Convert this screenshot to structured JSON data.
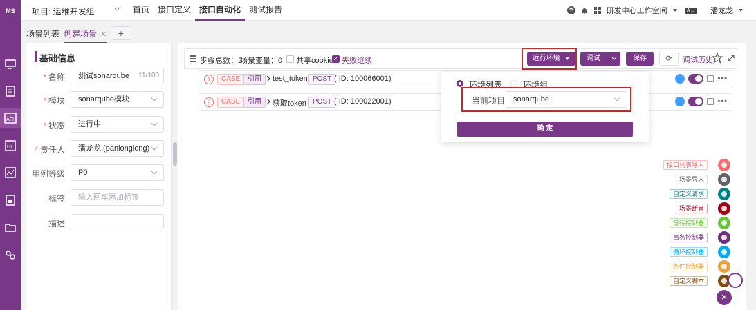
{
  "app": {
    "logo_text": "MS",
    "accent_color": "#783887"
  },
  "topbar": {
    "project": "项目: 运维开发组",
    "nav": [
      "首页",
      "接口定义",
      "接口自动化",
      "测试报告"
    ],
    "active_nav": "接口自动化",
    "workspace": "研发中心工作空间",
    "lang_icon_text": "A↔",
    "user": "潘龙龙"
  },
  "tabs": {
    "list": "场景列表",
    "create": "创建场景",
    "add": "+"
  },
  "info": {
    "title": "基础信息",
    "fields": {
      "name": {
        "label": "名称",
        "value": "测试sonarqube",
        "count": "11/100"
      },
      "module": {
        "label": "模块",
        "value": "sonarqube模块"
      },
      "status": {
        "label": "状态",
        "value": "进行中"
      },
      "owner": {
        "label": "责任人",
        "value": "潘龙龙 (panlonglong)"
      },
      "level": {
        "label": "用例等级",
        "value": "P0"
      },
      "tags": {
        "label": "标签",
        "placeholder": "输入回车添加标签"
      },
      "desc": {
        "label": "描述",
        "value": ""
      }
    }
  },
  "toolbar": {
    "steps_total": "步骤总数：2",
    "vars_label": "场景变量",
    "vars_value": "：0",
    "share_cookie": "共享cookie",
    "continue_on_fail": "失败继续",
    "run_env": "运行环境",
    "debug": "调试",
    "save": "保存",
    "history": "调试历史"
  },
  "steps": [
    {
      "num": "1",
      "type": "CASE",
      "ref": "引用",
      "name": "test_token",
      "method": "POST",
      "id": "( ID: 100066001)"
    },
    {
      "num": "2",
      "type": "CASE",
      "ref": "引用",
      "name": "获取token",
      "method": "POST",
      "id": "( ID: 100022001)"
    }
  ],
  "env_popover": {
    "env_list": "环境列表",
    "env_group": "环境组",
    "current_project_label": "当前项目",
    "current_project_value": "sonarqube",
    "confirm": "确 定"
  },
  "add_menu": [
    {
      "label": "接口列表导入",
      "color": "#f56c6c"
    },
    {
      "label": "场景导入",
      "color": "#606266"
    },
    {
      "label": "自定义请求",
      "color": "#008080"
    },
    {
      "label": "场景断言",
      "color": "#a30014"
    },
    {
      "label": "等待控制器",
      "color": "#67c23a"
    },
    {
      "label": "事务控制器",
      "color": "#6d317c"
    },
    {
      "label": "循环控制器",
      "color": "#02a7f0"
    },
    {
      "label": "条件控制器",
      "color": "#e6a23c"
    },
    {
      "label": "自定义脚本",
      "color": "#7b4d12"
    }
  ]
}
